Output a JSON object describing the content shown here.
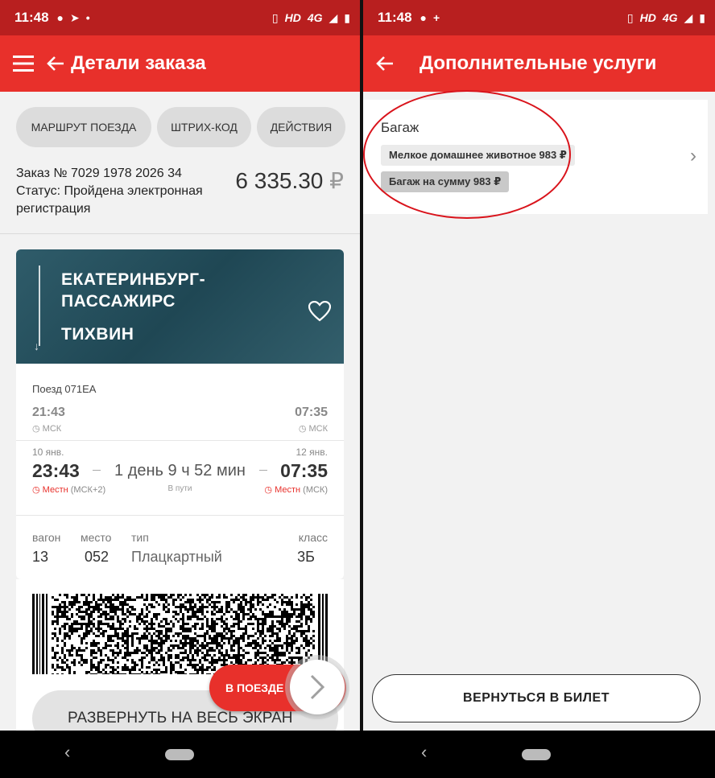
{
  "status_bar": {
    "left_time": "11:48",
    "right_time": "11:48",
    "network": "HD",
    "network_type": "4G"
  },
  "left": {
    "title": "Детали заказа",
    "chips": [
      "МАРШРУТ ПОЕЗДА",
      "ШТРИХ-КОД",
      "ДЕЙСТВИЯ"
    ],
    "order_number": "Заказ № 7029 1978 2026 34",
    "status": "Статус: Пройдена электронная регистрация",
    "price_amount": "6 335.30",
    "currency": "₽",
    "ticket": {
      "from": "ЕКАТЕРИНБУРГ-ПАССАЖИРС",
      "to": "ТИХВИН",
      "train": "Поезд 071ЕА",
      "dep_msk_time": "21:43",
      "arr_msk_time": "07:35",
      "msk_label": "МСК",
      "dep_date": "10 янв.",
      "arr_date": "12 янв.",
      "dep_local_time": "23:43",
      "arr_local_time": "07:35",
      "duration": "1 день 9 ч 52 мин",
      "en_route": "В пути",
      "local_word": "Местн",
      "dep_zone": "(МСК+2)",
      "arr_zone": "(МСК)",
      "wagon_label": "вагон",
      "wagon": "13",
      "seat_label": "место",
      "seat": "052",
      "type_label": "тип",
      "type": "Плацкартный",
      "class_label": "класс",
      "class": "3Б"
    },
    "expand_label": "РАЗВЕРНУТЬ НА ВЕСЬ ЭКРАН",
    "onboard_label": "В ПОЕЗДЕ"
  },
  "right": {
    "title": "Дополнительные услуги",
    "section": "Багаж",
    "items": [
      "Мелкое домашнее животное 983 ₽",
      "Багаж на сумму 983 ₽"
    ],
    "back_label": "ВЕРНУТЬСЯ В БИЛЕТ"
  },
  "colors": {
    "app_bar": "#e8302b",
    "status_bar": "#b81f1f",
    "annotation": "#d9131b"
  },
  "icons": [
    "menu-icon",
    "back-arrow-icon",
    "heart-icon",
    "chevron-right-icon",
    "clock-icon"
  ]
}
